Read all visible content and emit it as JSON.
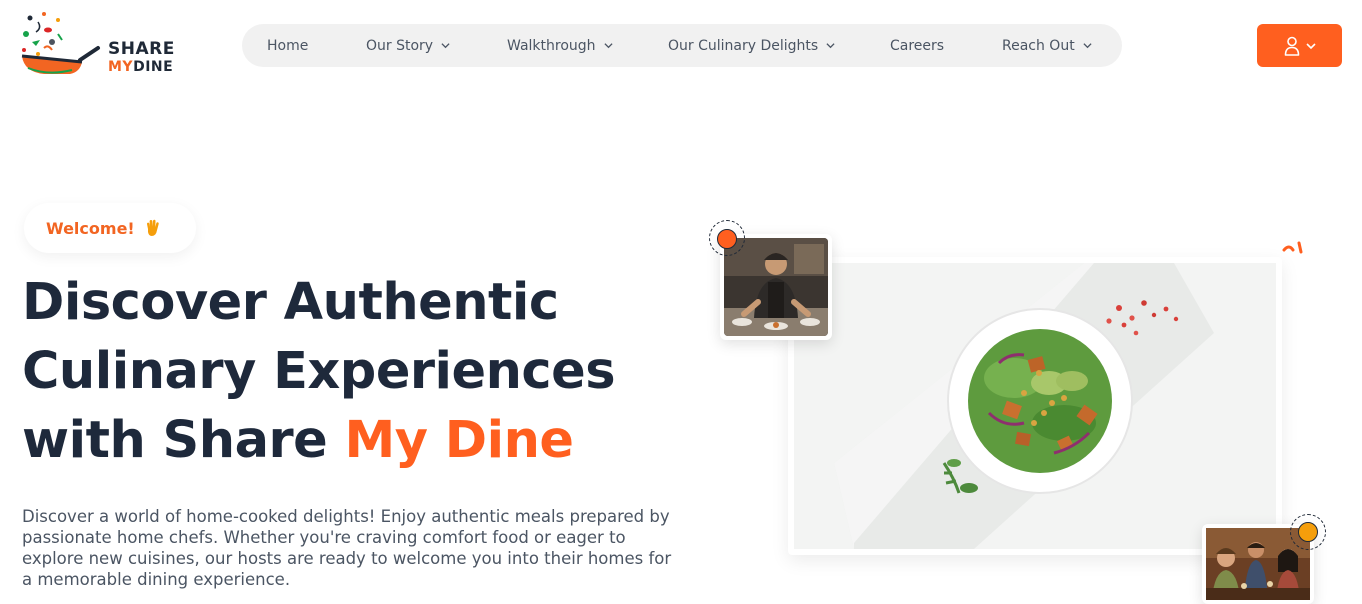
{
  "brand": {
    "line1": "SHARE",
    "line2_accent": "MY",
    "line2_rest": "DINE",
    "accent_color": "#f26522"
  },
  "nav": {
    "items": [
      {
        "label": "Home",
        "has_dropdown": false
      },
      {
        "label": "Our Story",
        "has_dropdown": true
      },
      {
        "label": "Walkthrough",
        "has_dropdown": true
      },
      {
        "label": "Our Culinary Delights",
        "has_dropdown": true
      },
      {
        "label": "Careers",
        "has_dropdown": false
      },
      {
        "label": "Reach Out",
        "has_dropdown": true
      }
    ]
  },
  "account": {
    "icon": "user-icon",
    "dropdown_icon": "chevron-down-icon",
    "color": "#ff5f1f"
  },
  "hero": {
    "welcome": "Welcome!",
    "welcome_icon": "waving-hand-icon",
    "headline_line1": "Discover Authentic",
    "headline_line2": "Culinary Experiences",
    "headline_line3_prefix": "with Share ",
    "headline_line3_accent": "My Dine",
    "description": "Discover a world of home-cooked delights! Enjoy authentic meals prepared by passionate home chefs. Whether you're craving comfort food or eager to explore new cuisines, our hosts are ready to welcome you into their homes for a memorable dining experience."
  },
  "images": {
    "main": "salad-bowl-image",
    "top": "chef-cooking-image",
    "bottom": "friends-dining-image"
  },
  "colors": {
    "accent": "#ff5f1f",
    "heading": "#1e293b",
    "body_text": "#4b5563",
    "nav_bg": "#f1f1f1",
    "dot_yellow": "#f59e0b"
  }
}
